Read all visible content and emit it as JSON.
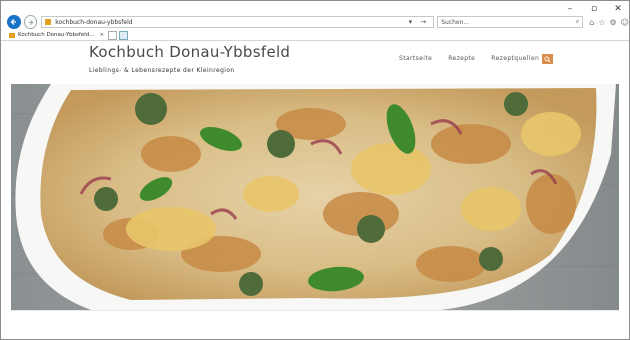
{
  "browser": {
    "window_controls": {
      "minimize": "–",
      "restore": "▫",
      "close": "✕"
    },
    "back_icon": "back-arrow-icon",
    "forward_icon": "forward-arrow-icon",
    "address_url": "kochbuch-donau-ybbsfeld",
    "address_icons": "▾ →",
    "search_placeholder": "Suchen...",
    "search_icon": "⌕",
    "toolbar_icons": [
      "⌂",
      "☆",
      "⚙",
      "☺"
    ],
    "tab_title": "Kochbuch Donau-Ybbsfeld...",
    "tab_close": "×"
  },
  "site": {
    "title": "Kochbuch Donau-Ybbsfeld",
    "tagline": "Lieblings- & Lebensrezepte der Kleinregion",
    "nav": [
      "Startseite",
      "Rezepte",
      "Rezeptquellen"
    ],
    "accent_color": "#d98e4a"
  }
}
